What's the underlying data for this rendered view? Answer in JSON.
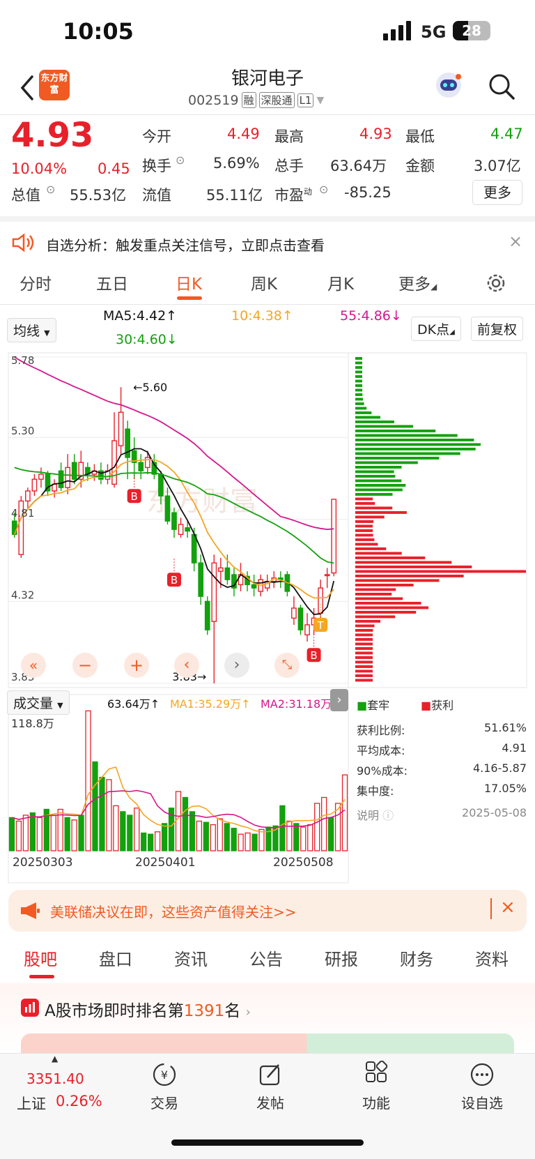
{
  "status_bar": {
    "time": "10:05",
    "network": "5G",
    "battery": "28"
  },
  "header": {
    "name": "银河电子",
    "code": "002519",
    "tags": [
      "融",
      "深股通",
      "L1"
    ],
    "logo_text": "东方财富"
  },
  "quote": {
    "price": "4.93",
    "change_pct": "10.04%",
    "change": "0.45",
    "fields": [
      {
        "label": "今开",
        "value": "4.49"
      },
      {
        "label": "最高",
        "value": "4.93"
      },
      {
        "label": "最低",
        "value": "4.47"
      },
      {
        "label": "换手",
        "value": "5.69%"
      },
      {
        "label": "总手",
        "value": "63.64万"
      },
      {
        "label": "金额",
        "value": "3.07亿"
      },
      {
        "label": "总值",
        "value": "55.53亿"
      },
      {
        "label": "流值",
        "value": "55.11亿"
      },
      {
        "label": "市盈",
        "label_sup": "动",
        "value": "-85.25"
      }
    ],
    "more": "更多"
  },
  "notice": {
    "text": "自选分析：触发重点关注信号，立即点击查看"
  },
  "chart_tabs": [
    "分时",
    "五日",
    "日K",
    "周K",
    "月K",
    "更多"
  ],
  "indicator_bar": {
    "select": "均线",
    "ma5": "MA5:4.42↑",
    "ma10": "10:4.38↑",
    "ma55": "55:4.86↓",
    "ma30": "30:4.60↓",
    "dk": "DK点",
    "adjust": "前复权"
  },
  "chart_data": {
    "type": "candlestick",
    "y_labels": [
      "5.78",
      "5.30",
      "4.81",
      "4.32",
      "3.83"
    ],
    "ylim": [
      3.83,
      5.78
    ],
    "annotations": [
      "←5.60",
      "3.83→"
    ],
    "markers": [
      "B",
      "B",
      "B",
      "T"
    ],
    "colors": {
      "up": "#e8202a",
      "down": "#13a10e",
      "ma5": "#111111",
      "ma10": "#f5a623",
      "ma30": "#13a10e",
      "ma55": "#d6168c"
    },
    "candles": [
      [
        4.8,
        4.72,
        4.85,
        4.7
      ],
      [
        4.6,
        4.92,
        4.95,
        4.58
      ],
      [
        4.92,
        4.98,
        5.0,
        4.88
      ],
      [
        4.98,
        5.05,
        5.08,
        4.95
      ],
      [
        5.05,
        5.08,
        5.12,
        5.0
      ],
      [
        5.08,
        4.98,
        5.1,
        4.95
      ],
      [
        4.98,
        5.02,
        5.05,
        4.94
      ],
      [
        5.1,
        5.0,
        5.15,
        4.98
      ],
      [
        5.0,
        5.12,
        5.2,
        4.96
      ],
      [
        5.15,
        5.05,
        5.2,
        5.02
      ],
      [
        5.05,
        5.15,
        5.22,
        5.0
      ],
      [
        5.12,
        5.08,
        5.15,
        5.04
      ],
      [
        5.08,
        5.1,
        5.14,
        5.04
      ],
      [
        5.1,
        5.05,
        5.15,
        5.02
      ],
      [
        5.05,
        5.1,
        5.14,
        5.02
      ],
      [
        5.02,
        5.28,
        5.45,
        5.0
      ],
      [
        5.25,
        5.45,
        5.6,
        5.2
      ],
      [
        5.35,
        5.18,
        5.4,
        5.05
      ],
      [
        5.22,
        5.15,
        5.3,
        5.05
      ],
      [
        5.15,
        5.1,
        5.2,
        5.05
      ],
      [
        5.12,
        5.18,
        5.22,
        5.08
      ],
      [
        5.15,
        5.08,
        5.2,
        5.05
      ],
      [
        5.08,
        4.95,
        5.1,
        4.9
      ],
      [
        4.95,
        4.8,
        5.0,
        4.78
      ],
      [
        4.85,
        4.75,
        4.88,
        4.7
      ],
      [
        4.72,
        4.78,
        4.82,
        4.7
      ],
      [
        4.76,
        4.74,
        4.8,
        4.7
      ],
      [
        4.72,
        4.55,
        4.76,
        4.5
      ],
      [
        4.55,
        4.35,
        4.6,
        4.3
      ],
      [
        4.32,
        4.15,
        4.35,
        4.12
      ],
      [
        4.2,
        4.55,
        4.6,
        3.83
      ],
      [
        4.5,
        4.52,
        4.58,
        4.4
      ],
      [
        4.52,
        4.45,
        4.6,
        4.42
      ],
      [
        4.48,
        4.4,
        4.52,
        4.35
      ],
      [
        4.42,
        4.48,
        4.55,
        4.38
      ],
      [
        4.47,
        4.42,
        4.5,
        4.38
      ],
      [
        4.42,
        4.4,
        4.48,
        4.35
      ],
      [
        4.38,
        4.45,
        4.48,
        4.35
      ],
      [
        4.4,
        4.44,
        4.48,
        4.38
      ],
      [
        4.44,
        4.46,
        4.5,
        4.4
      ],
      [
        4.46,
        4.45,
        4.5,
        4.4
      ],
      [
        4.48,
        4.38,
        4.5,
        4.35
      ],
      [
        4.22,
        4.28,
        4.35,
        4.18
      ],
      [
        4.28,
        4.15,
        4.3,
        4.12
      ],
      [
        4.12,
        4.18,
        4.25,
        4.08
      ],
      [
        4.18,
        4.22,
        4.28,
        4.12
      ],
      [
        4.25,
        4.4,
        4.45,
        4.2
      ],
      [
        4.48,
        4.48,
        4.52,
        4.4
      ],
      [
        4.49,
        4.93,
        4.93,
        4.47
      ]
    ],
    "volume_label": "成交量",
    "volume_values": [
      "63.64万↑",
      "MA1:35.29万↑",
      "MA2:31.18万↑"
    ],
    "volume_max": "118.8万",
    "volumes": [
      [
        28,
        "d"
      ],
      [
        25,
        "u"
      ],
      [
        30,
        "u"
      ],
      [
        32,
        "d"
      ],
      [
        28,
        "u"
      ],
      [
        35,
        "d"
      ],
      [
        30,
        "u"
      ],
      [
        35,
        "u"
      ],
      [
        28,
        "d"
      ],
      [
        26,
        "u"
      ],
      [
        30,
        "d"
      ],
      [
        118,
        "u"
      ],
      [
        75,
        "d"
      ],
      [
        62,
        "d"
      ],
      [
        60,
        "u"
      ],
      [
        38,
        "u"
      ],
      [
        33,
        "d"
      ],
      [
        30,
        "d"
      ],
      [
        36,
        "u"
      ],
      [
        15,
        "d"
      ],
      [
        14,
        "d"
      ],
      [
        16,
        "u"
      ],
      [
        23,
        "d"
      ],
      [
        36,
        "d"
      ],
      [
        50,
        "u"
      ],
      [
        45,
        "d"
      ],
      [
        33,
        "d"
      ],
      [
        25,
        "u"
      ],
      [
        24,
        "d"
      ],
      [
        22,
        "u"
      ],
      [
        27,
        "u"
      ],
      [
        23,
        "d"
      ],
      [
        19,
        "d"
      ],
      [
        14,
        "u"
      ],
      [
        15,
        "u"
      ],
      [
        14,
        "d"
      ],
      [
        18,
        "u"
      ],
      [
        20,
        "d"
      ],
      [
        21,
        "d"
      ],
      [
        38,
        "d"
      ],
      [
        25,
        "u"
      ],
      [
        23,
        "d"
      ],
      [
        20,
        "u"
      ],
      [
        22,
        "u"
      ],
      [
        40,
        "u"
      ],
      [
        45,
        "u"
      ],
      [
        28,
        "d"
      ],
      [
        40,
        "u"
      ],
      [
        64,
        "u"
      ]
    ],
    "x_labels": [
      "20250303",
      "20250401",
      "20250508"
    ]
  },
  "chip": {
    "legend": [
      "套牢",
      "获利"
    ],
    "stats": [
      {
        "label": "获利比例:",
        "value": "51.61%"
      },
      {
        "label": "平均成本:",
        "value": "4.91"
      },
      {
        "label": "90%成本:",
        "value": "4.16-5.87"
      },
      {
        "label": "集中度:",
        "value": "17.05%"
      },
      {
        "label": "说明",
        "value": "2025-05-08"
      }
    ]
  },
  "ad": {
    "text": "美联储决议在即，这些资产值得关注>>"
  },
  "bottom_tabs": [
    "股吧",
    "盘口",
    "资讯",
    "公告",
    "研报",
    "财务",
    "资料"
  ],
  "rank": {
    "prefix": "A股市场即时排名第",
    "number": "1391",
    "suffix": "名"
  },
  "bottom_bar": {
    "index_value": "3351.40",
    "index_name": "上证",
    "index_pct": "0.26%",
    "items": [
      "交易",
      "发帖",
      "功能",
      "设自选"
    ]
  }
}
